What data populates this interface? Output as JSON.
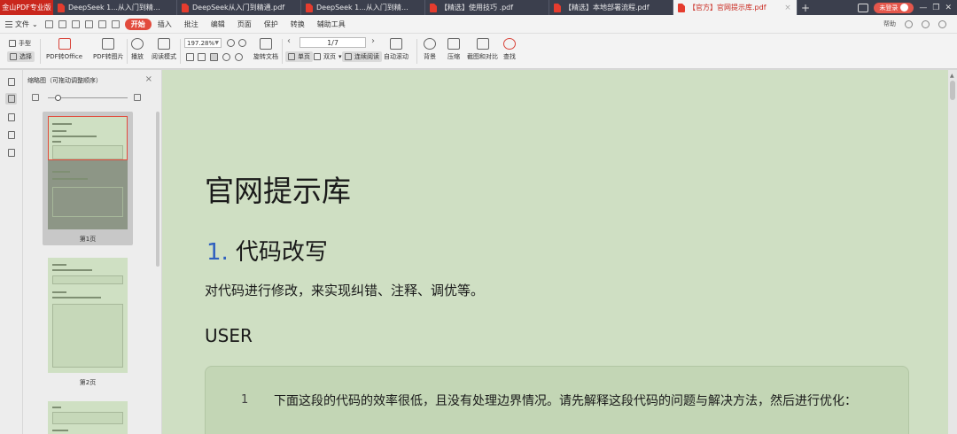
{
  "app_tab": "金山PDF专业版",
  "tabs": [
    {
      "title": "DeepSeek 1...从入门到精通.pdf",
      "active": false
    },
    {
      "title": "DeepSeek从入门到精通.pdf",
      "active": false
    },
    {
      "title": "DeepSeek 1...从入门到精通.pdf",
      "active": false
    },
    {
      "title": "【精选】使用技巧 .pdf",
      "active": false
    },
    {
      "title": "【精选】本地部署流程.pdf",
      "active": false
    },
    {
      "title": "【官方】官网提示库.pdf",
      "active": true
    }
  ],
  "user_label": "未登录",
  "menu": {
    "file": "文件",
    "items": [
      "开始",
      "插入",
      "批注",
      "编辑",
      "页面",
      "保护",
      "转换",
      "辅助工具"
    ],
    "active": "开始",
    "right_label": "帮助"
  },
  "ribbon": {
    "hand": "手型",
    "select": "选择",
    "pdf_to_office": "PDF转Office",
    "pdf_to_image": "PDF转图片",
    "play": "播放",
    "read_mode": "阅读模式",
    "zoom": "197.28%",
    "rotate_doc": "旋转文档",
    "single_page": "单页",
    "double_page": "双页",
    "continuous": "连续阅读",
    "auto_scroll": "自动滚动",
    "background": "背景",
    "compress": "压缩",
    "screenshot_compare": "截图和对比",
    "find": "查找",
    "page_indicator": "1/7"
  },
  "thumbnails": {
    "title": "缩略图（可拖动调整顺序）",
    "pages": [
      "第1页",
      "第2页"
    ]
  },
  "document": {
    "title": "官网提示库",
    "section_number": "1.",
    "section_title": "代码改写",
    "section_desc": "对代码进行修改，来实现纠错、注释、调优等。",
    "role_label": "USER",
    "line_number": "1",
    "line_text": "下面这段的代码的效率很低，且没有处理边界情况。请先解释这段代码的问题与解决方法，然后进行优化："
  },
  "colors": {
    "accent": "#e24b3d",
    "doc_background": "#cfdfc3",
    "heading_number": "#2f5fbf"
  }
}
